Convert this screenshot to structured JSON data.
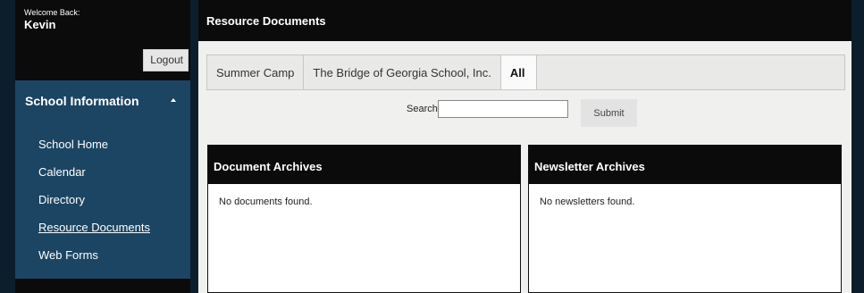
{
  "user": {
    "welcome_label": "Welcome Back:",
    "name": "Kevin",
    "logout_label": "Logout"
  },
  "sidebar": {
    "section_title": "School Information",
    "items": [
      {
        "label": "School Home"
      },
      {
        "label": "Calendar"
      },
      {
        "label": "Directory"
      },
      {
        "label": "Resource Documents",
        "active": true
      },
      {
        "label": "Web Forms"
      }
    ]
  },
  "main": {
    "title": "Resource Documents",
    "tabs": [
      {
        "label": "Summer Camp"
      },
      {
        "label": "The Bridge of Georgia School, Inc."
      },
      {
        "label": "All",
        "selected": true
      }
    ],
    "search": {
      "label": "Search:",
      "value": "",
      "placeholder": "",
      "submit_label": "Submit"
    },
    "document_archives": {
      "title": "Document Archives",
      "message": "No documents found."
    },
    "newsletter_archives": {
      "title": "Newsletter Archives",
      "message": "No newsletters found."
    }
  },
  "colors": {
    "sidebar_section": "#1c4563",
    "header_black": "#0b0b0b",
    "background": "#0c1e2c"
  }
}
